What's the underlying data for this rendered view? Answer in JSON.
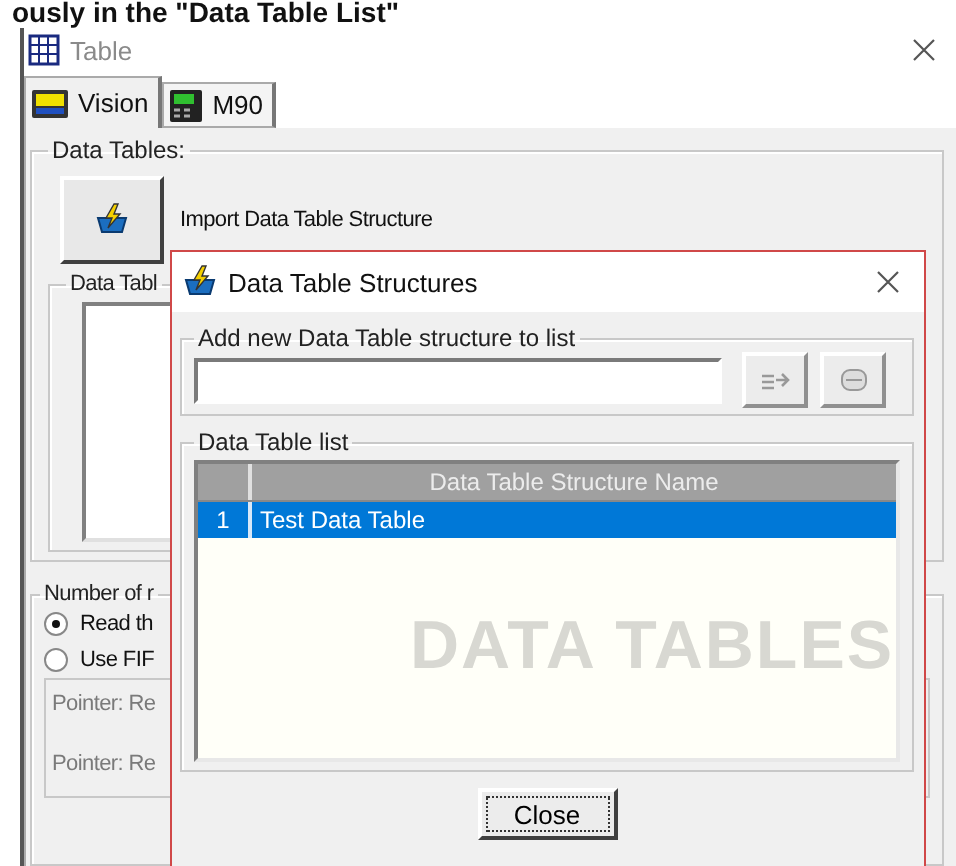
{
  "caption": "ously in the \"Data Table List\"",
  "window": {
    "title": "Table"
  },
  "tabs": [
    {
      "label": "Vision",
      "kind": "vision",
      "selected": true
    },
    {
      "label": "M90",
      "kind": "m90",
      "selected": false
    }
  ],
  "data_tables": {
    "legend": "Data Tables:",
    "import_label": "Import Data Table Structure",
    "list_legend": "Data Tabl"
  },
  "records": {
    "legend": "Number of r",
    "options": [
      {
        "label": "Read th",
        "selected": true
      },
      {
        "label": "Use FIF",
        "selected": false
      }
    ],
    "pointers": [
      {
        "label": "Pointer: Re",
        "disabled": true
      },
      {
        "label": "Pointer: Re",
        "disabled": true
      }
    ]
  },
  "dialog": {
    "title": "Data Table Structures",
    "add_legend": "Add new Data Table structure to list",
    "list_legend": "Data Table list",
    "column": "Data Table Structure Name",
    "rows": [
      {
        "number": "1",
        "name": "Test Data Table",
        "selected": true
      }
    ],
    "background_text": "DATA TABLES",
    "close": "Close"
  }
}
